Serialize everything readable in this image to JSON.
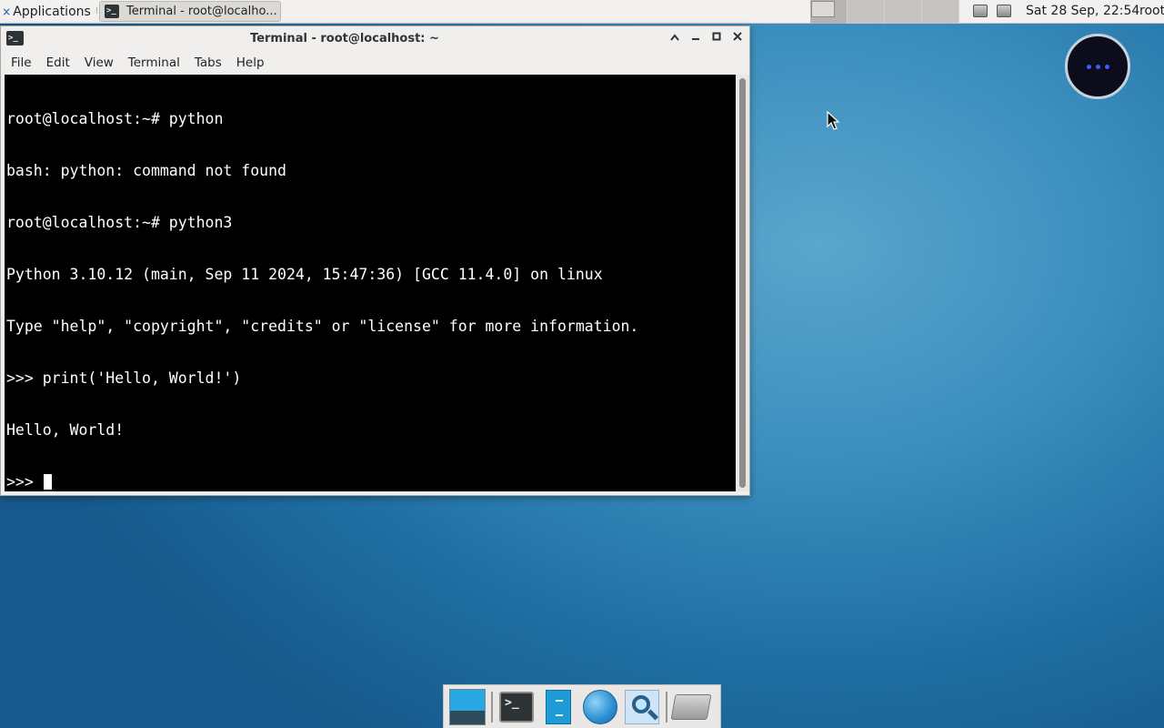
{
  "top_panel": {
    "applications_label": "Applications",
    "task_title": "Terminal - root@localho...",
    "clock": "Sat 28 Sep, 22:54",
    "user": "root",
    "workspace_count": 4,
    "active_workspace": 1
  },
  "window": {
    "title": "Terminal - root@localhost: ~",
    "menu": [
      "File",
      "Edit",
      "View",
      "Terminal",
      "Tabs",
      "Help"
    ]
  },
  "terminal": {
    "lines": [
      "root@localhost:~# python",
      "bash: python: command not found",
      "root@localhost:~# python3",
      "Python 3.10.12 (main, Sep 11 2024, 15:47:36) [GCC 11.4.0] on linux",
      "Type \"help\", \"copyright\", \"credits\" or \"license\" for more information.",
      ">>> print('Hello, World!')",
      "Hello, World!"
    ],
    "prompt": ">>> "
  },
  "dock": {
    "items": [
      "show-desktop",
      "terminal",
      "file-manager",
      "web-browser",
      "app-finder",
      "drive"
    ]
  },
  "colors": {
    "terminal_bg": "#000000",
    "terminal_fg": "#ffffff",
    "desktop_bg": "#2b7fb3",
    "assist_dots": "#3e5cff"
  }
}
